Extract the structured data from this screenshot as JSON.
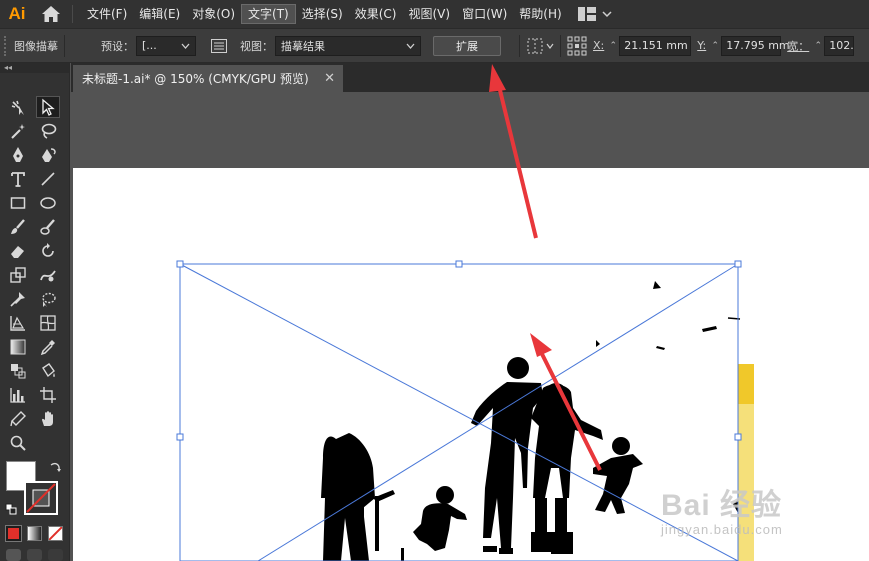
{
  "app": {
    "logo_text": "Ai"
  },
  "menu": [
    "文件(F)",
    "编辑(E)",
    "对象(O)",
    "文字(T)",
    "选择(S)",
    "效果(C)",
    "视图(V)",
    "窗口(W)",
    "帮助(H)"
  ],
  "menu_active_index": 3,
  "control": {
    "panel_label": "图像描摹",
    "preset_label": "预设：",
    "preset_value": "[...",
    "view_label": "视图：",
    "view_value": "描摹结果",
    "expand_button": "扩展",
    "x_label": "X:",
    "x_value": "21.151 mm",
    "y_label": "Y:",
    "y_value": "17.795 mm",
    "w_label": "宽：",
    "w_value": "102."
  },
  "toolbar": {
    "collapse_label": "◂◂"
  },
  "document": {
    "tab_title": "未标题-1.ai* @ 150% (CMYK/GPU 预览)",
    "close_glyph": "✕"
  },
  "colors": {
    "menubar_bg": "#323232",
    "controlbar_bg": "#3c3c3c",
    "canvas_bg": "#535353",
    "selection_blue": "#4a78d8",
    "annotation_red": "#e8373b",
    "logo_orange": "#ff9a00"
  },
  "watermark": {
    "main": "Bai 经验",
    "sub": "jingyan.baidu.com"
  }
}
